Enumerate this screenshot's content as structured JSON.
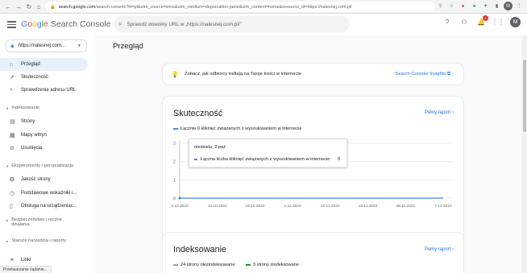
{
  "browser": {
    "url_host": "search.google.com",
    "url_rest": "/search-console?hl=pl&utm_source=wmx&utm_medium=deprecation-pane&utm_content=home&resource_id=https://nalesnej.com.pl/",
    "notification_count": "4",
    "profile_initial": "M"
  },
  "header": {
    "logo_google": [
      "G",
      "o",
      "o",
      "g",
      "l",
      "e"
    ],
    "logo_rest": "Search Console",
    "search_placeholder": "Sprawdź dowolny URL w „https://nalesnej.com.pl/\""
  },
  "sidebar": {
    "property": "https://nalesnej.com...",
    "items": [
      {
        "label": "Przegląd",
        "icon": "home-icon"
      },
      {
        "label": "Skuteczność",
        "icon": "trending-icon"
      },
      {
        "label": "Sprawdzenie adresu URL",
        "icon": "search-icon"
      }
    ],
    "section_indexing": "Indeksowanie",
    "indexing_items": [
      {
        "label": "Strony",
        "icon": "pages-icon"
      },
      {
        "label": "Mapy witryn",
        "icon": "sitemap-icon"
      },
      {
        "label": "Usunięcia",
        "icon": "removals-icon"
      }
    ],
    "section_experience": "Eksperymenty i personalizacja",
    "experience_items": [
      {
        "label": "Jakość strony",
        "icon": "page-quality-icon"
      },
      {
        "label": "Podstawowe wskaźniki i...",
        "icon": "vitals-icon"
      },
      {
        "label": "Obsługa na urządzeniac...",
        "icon": "mobile-icon"
      }
    ],
    "section_security": "Bezpieczeństwo i ręczne działania",
    "section_legacy": "Starsze narzędzia i raporty",
    "links_item": {
      "label": "Linki",
      "icon": "links-icon"
    }
  },
  "main": {
    "title": "Przegląd",
    "insight_text": "Zobacz, jak odbiorcy trafiają na Twoje treści w internecie",
    "insight_link": "Search Console Insights",
    "performance": {
      "title": "Skuteczność",
      "full_report": "Pełny raport",
      "legend": "Łącznie 0 kliknięć związanych z wyszukiwaniem w internecie",
      "tooltip_date": "niedziela, 2 paź",
      "tooltip_label": "Łączna liczba kliknięć związanych z wyszukiwaniem w internecie",
      "tooltip_value": "0"
    },
    "indexing": {
      "title": "Indeksowanie",
      "full_report": "Pełny raport",
      "not_indexed": "24 strony niezindeksowane",
      "indexed": "3 strony zindeksowane",
      "not_indexed_color": "#9aa0a6",
      "indexed_color": "#1e8e3e"
    }
  },
  "status_text": "Przetwarzanie żądanie...",
  "chart_data": {
    "type": "line",
    "x": [
      "2.10.2022",
      "14.10.2022",
      "23.10.2022",
      "1.11.2022",
      "10.11.2022",
      "19.11.2022",
      "28.11.2022",
      "7.12.2022"
    ],
    "yticks": [
      "3",
      "2",
      "1",
      "0"
    ],
    "ylim": [
      0,
      3
    ],
    "series": [
      {
        "name": "Łącznie 0 kliknięć związanych z wyszukiwaniem w internecie",
        "values": [
          0,
          0,
          0,
          0,
          0,
          0,
          0,
          0
        ],
        "color": "#4285f4"
      }
    ]
  }
}
